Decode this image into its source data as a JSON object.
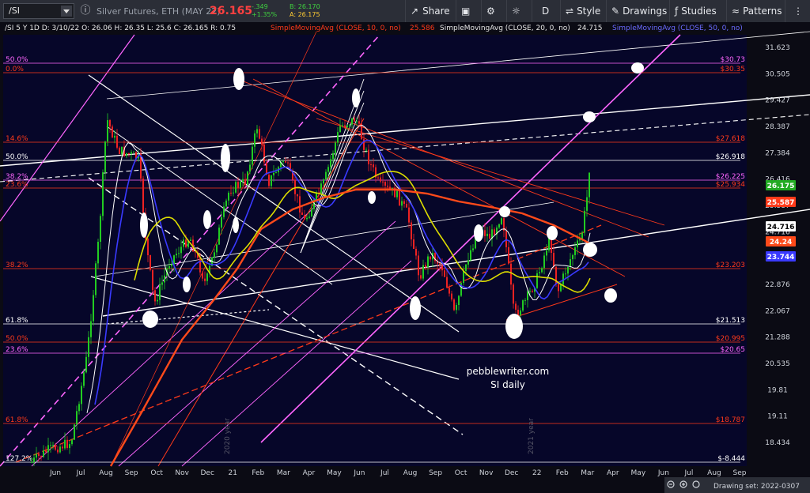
{
  "toolbar": {
    "symbol": "/SI",
    "description": "Silver Futures, ETH (MAY 22)",
    "last_price": "26.165",
    "change_abs": "-.349",
    "change_pct": "+1.35%",
    "bid": "B: 26.170",
    "ask": "A: 26.175",
    "share_label": "Share",
    "timeframe_label": "D",
    "style_label": "Style",
    "drawings_label": "Drawings",
    "studies_label": "Studies",
    "patterns_label": "Patterns"
  },
  "legend": {
    "ohlc": "/SI 5 Y 1D   D: 3/10/22   O: 26.06   H: 26.35   L: 25.6   C: 26.165   R: 0.75",
    "sma10": "SimpleMovingAvg (CLOSE, 10, 0, no)",
    "sma10_value": "25.586",
    "sma20": "SimpleMovingAvg (CLOSE, 20, 0, no)",
    "sma20_value": "24.715",
    "sma50": "SimpleMovingAvg (CLOSE, 50, 0, no)"
  },
  "watermark": {
    "line1": "pebblewriter.com",
    "line2": "SI daily"
  },
  "year_marks": [
    "2020 year",
    "2021 year"
  ],
  "footer": {
    "drawing_set": "Drawing set: 2022-0307"
  },
  "colors": {
    "background": "#060629",
    "price_up": "#22cc22",
    "price_down": "#ee2222",
    "sma10": "#3a3aff",
    "sma20": "#dddd00",
    "sma50": "#ff4a1a",
    "fib_red": "#ff3a1a",
    "fib_magenta": "#ff66ff"
  },
  "chart_data": {
    "type": "candlestick",
    "title": "",
    "y_axis_ticks": [
      "31.623",
      "30.505",
      "29.427",
      "28.387",
      "27.384",
      "26.416",
      "25.587",
      "24.716",
      "23.876",
      "22.876",
      "22.067",
      "21.288",
      "20.535",
      "19.81",
      "19.11",
      "18.434"
    ],
    "x_axis_ticks": [
      "Jun",
      "Jul",
      "Aug",
      "Sep",
      "Oct",
      "Nov",
      "Dec",
      "21",
      "Feb",
      "Mar",
      "Apr",
      "May",
      "Jun",
      "Jul",
      "Aug",
      "Sep",
      "Oct",
      "Nov",
      "Dec",
      "22",
      "Feb",
      "Mar",
      "Apr",
      "May",
      "Jun",
      "Jul",
      "Aug",
      "Sep"
    ],
    "price_badges": [
      {
        "value": "26.175",
        "color": "#22aa22"
      },
      {
        "value": "25.587",
        "color": "#ff3a1a"
      },
      {
        "value": "24.716",
        "color": "#ffffff"
      },
      {
        "value": "24.24",
        "color": "#ff4a1a"
      },
      {
        "value": "23.744",
        "color": "#3a3aff"
      }
    ],
    "fib_levels_left": [
      {
        "label": "50.0%",
        "color": "#ff66ff"
      },
      {
        "label": "0.0%",
        "color": "#ff3a1a"
      },
      {
        "label": "14.6%",
        "color": "#ff3a1a"
      },
      {
        "label": "50.0%",
        "color": "#ffffff"
      },
      {
        "label": "38.2%",
        "color": "#ff66ff"
      },
      {
        "label": "23.6%",
        "color": "#ff3a1a"
      },
      {
        "label": "38.2%",
        "color": "#ff3a1a"
      },
      {
        "label": "61.8%",
        "color": "#ffffff"
      },
      {
        "label": "50.0%",
        "color": "#ff3a1a"
      },
      {
        "label": "23.6%",
        "color": "#ff66ff"
      },
      {
        "label": "61.8%",
        "color": "#ff3a1a"
      },
      {
        "label": "127.2%",
        "color": "#ffffff"
      }
    ],
    "fib_levels_right": [
      {
        "label": "$30.73",
        "color": "#ff66ff"
      },
      {
        "label": "$30.35",
        "color": "#ff3a1a"
      },
      {
        "label": "$27.618",
        "color": "#ff3a1a"
      },
      {
        "label": "$26.918",
        "color": "#ffffff"
      },
      {
        "label": "$26.225",
        "color": "#ff66ff"
      },
      {
        "label": "$25.934",
        "color": "#ff3a1a"
      },
      {
        "label": "$23.203",
        "color": "#ff3a1a"
      },
      {
        "label": "$21.513",
        "color": "#ffffff"
      },
      {
        "label": "$20.995",
        "color": "#ff3a1a"
      },
      {
        "label": "$20.65",
        "color": "#ff66ff"
      },
      {
        "label": "$18.787",
        "color": "#ff3a1a"
      },
      {
        "label": "$-8.444",
        "color": "#ffffff"
      }
    ]
  }
}
